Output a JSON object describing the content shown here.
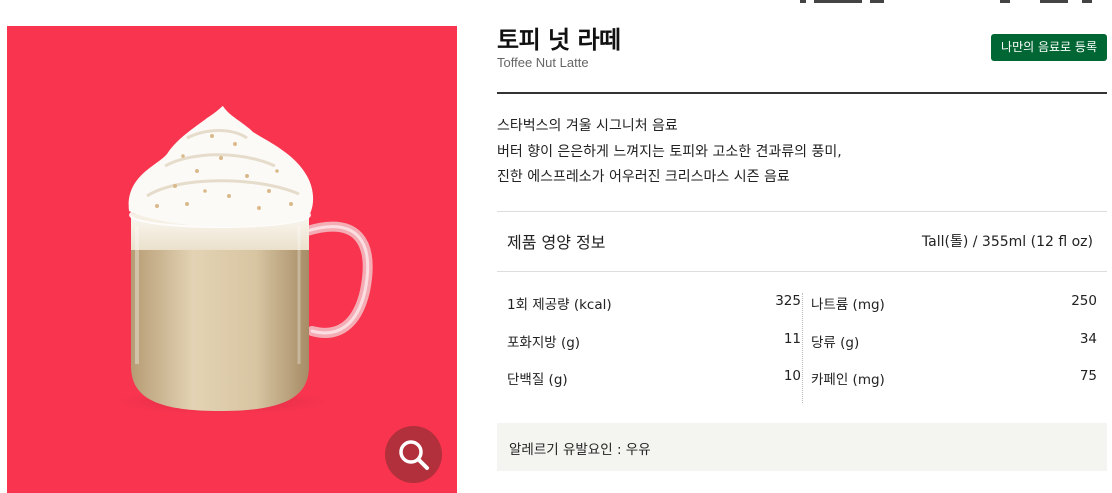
{
  "product": {
    "name_ko": "토피 넛 라떼",
    "name_en": "Toffee Nut Latte",
    "register_button_label": "나만의 음료로 등록",
    "description_lines": [
      "스타벅스의 겨울 시그니처 음료",
      "버터 향이 은은하게 느껴지는 토피와 고소한 견과류의 풍미,",
      "진한 에스프레소가 어우러진 크리스마스 시즌 음료"
    ]
  },
  "image": {
    "background_color": "#f9344f",
    "zoom_icon": "magnifier-icon"
  },
  "nutrition": {
    "title": "제품 영양 정보",
    "serving": "Tall(톨) / 355ml (12 fl oz)",
    "left_items": [
      {
        "label": "1회 제공량 (kcal)",
        "value": "325"
      },
      {
        "label": "포화지방 (g)",
        "value": "11"
      },
      {
        "label": "단백질 (g)",
        "value": "10"
      }
    ],
    "right_items": [
      {
        "label": "나트륨 (mg)",
        "value": "250"
      },
      {
        "label": "당류 (g)",
        "value": "34"
      },
      {
        "label": "카페인 (mg)",
        "value": "75"
      }
    ]
  },
  "allergy": {
    "text": "알레르기 유발요인 : 우유"
  },
  "colors": {
    "brand_green": "#006633",
    "zoom_button": "#b22f3c"
  }
}
